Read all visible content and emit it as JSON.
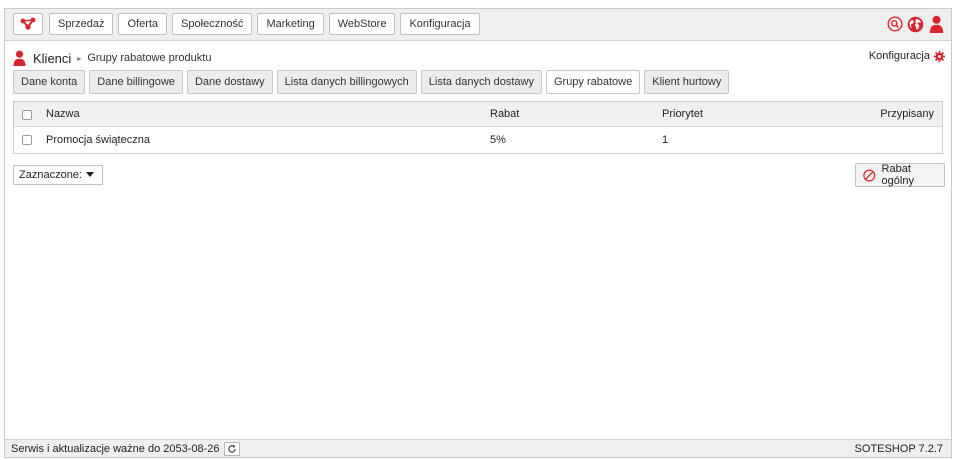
{
  "nav": {
    "logo_icon": "sote-logo-icon",
    "items": [
      "Sprzedaż",
      "Oferta",
      "Społeczność",
      "Marketing",
      "WebStore",
      "Konfiguracja"
    ]
  },
  "top_icons": [
    "search-icon",
    "globe-icon",
    "user-icon"
  ],
  "breadcrumb": {
    "main": "Klienci",
    "separator": "▸",
    "sub": "Grupy rabatowe produktu"
  },
  "config_link": {
    "label": "Konfiguracja",
    "icon": "gear-icon"
  },
  "tabs": [
    {
      "label": "Dane konta",
      "active": false
    },
    {
      "label": "Dane billingowe",
      "active": false
    },
    {
      "label": "Dane dostawy",
      "active": false
    },
    {
      "label": "Lista danych billingowych",
      "active": false
    },
    {
      "label": "Lista danych dostawy",
      "active": false
    },
    {
      "label": "Grupy rabatowe",
      "active": true
    },
    {
      "label": "Klient hurtowy",
      "active": false
    }
  ],
  "table": {
    "headers": {
      "name": "Nazwa",
      "rabat": "Rabat",
      "priorytet": "Priorytet",
      "przypisany": "Przypisany"
    },
    "rows": [
      {
        "name": "Promocja świąteczna",
        "rabat": "5%",
        "priorytet": "1",
        "przypisany": ""
      }
    ]
  },
  "selected_dropdown": {
    "value": "Zaznaczone:"
  },
  "rabat_button": {
    "label": "Rabat ogólny",
    "icon": "cancel-circle-icon"
  },
  "footer": {
    "left": "Serwis i aktualizacje ważne do 2053-08-26",
    "right": "SOTESHOP 7.2.7"
  },
  "colors": {
    "accent": "#d9262e",
    "bar_bg": "#efefef",
    "border": "#c9c9c9"
  }
}
